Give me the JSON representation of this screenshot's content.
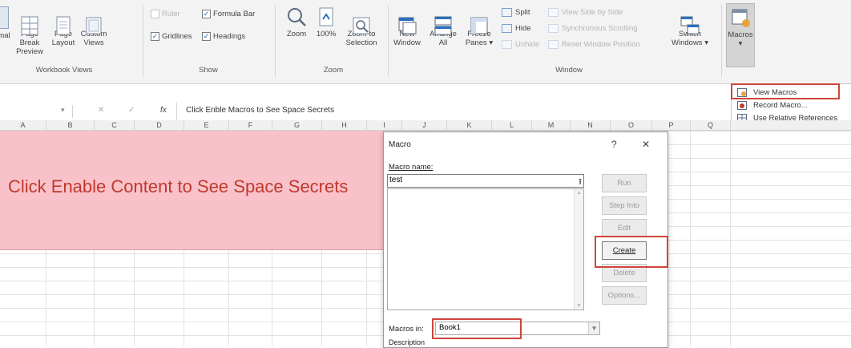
{
  "ribbon": {
    "workbook_views": {
      "normal_label": "mal",
      "page_break_label": "Page Break\nPreview",
      "page_layout_label": "Page\nLayout",
      "custom_views_label": "Custom\nViews",
      "group_label": "Workbook Views"
    },
    "show": {
      "ruler": "Ruler",
      "formula_bar": "Formula Bar",
      "gridlines": "Gridlines",
      "headings": "Headings",
      "group_label": "Show"
    },
    "zoom": {
      "zoom_label": "Zoom",
      "zoom100_label": "100%",
      "zoom_selection_label": "Zoom to\nSelection",
      "group_label": "Zoom"
    },
    "window": {
      "new_window": "New\nWindow",
      "arrange_all": "Arrange\nAll",
      "freeze_panes": "Freeze\nPanes ▾",
      "split": "Split",
      "hide": "Hide",
      "unhide": "Unhide",
      "view_side": "View Side by Side",
      "sync_scroll": "Synchronous Scrolling",
      "reset_pos": "Reset Window Position",
      "switch_windows": "Switch\nWindows ▾",
      "group_label": "Window"
    },
    "macros": {
      "label": "Macros",
      "arrow": "▾"
    }
  },
  "macros_menu": {
    "items": [
      "View Macros",
      "Record Macro...",
      "Use Relative References"
    ]
  },
  "formula_bar": {
    "fx": "fx",
    "cancel": "✕",
    "enter": "✓",
    "text": "Click Enble Macros to See Space Secrets"
  },
  "columns": [
    "A",
    "B",
    "C",
    "D",
    "E",
    "F",
    "G",
    "H",
    "I",
    "J",
    "K",
    "L",
    "M",
    "N",
    "O",
    "P",
    "Q"
  ],
  "cell_text": "Click Enable Content to See Space Secrets",
  "dialog": {
    "title": "Macro",
    "help": "?",
    "close": "✕",
    "macro_name_label": "Macro name:",
    "macro_name_value": "test",
    "buttons": [
      "Run",
      "Step Into",
      "Edit",
      "Create",
      "Delete",
      "Options..."
    ],
    "macros_in_label": "Macros in:",
    "macros_in_value": "Book1",
    "description_label": "Description"
  },
  "colors": {
    "highlight": "#d0453a",
    "pink_cell": "#f9c2cb",
    "red_text": "#c0392b"
  }
}
